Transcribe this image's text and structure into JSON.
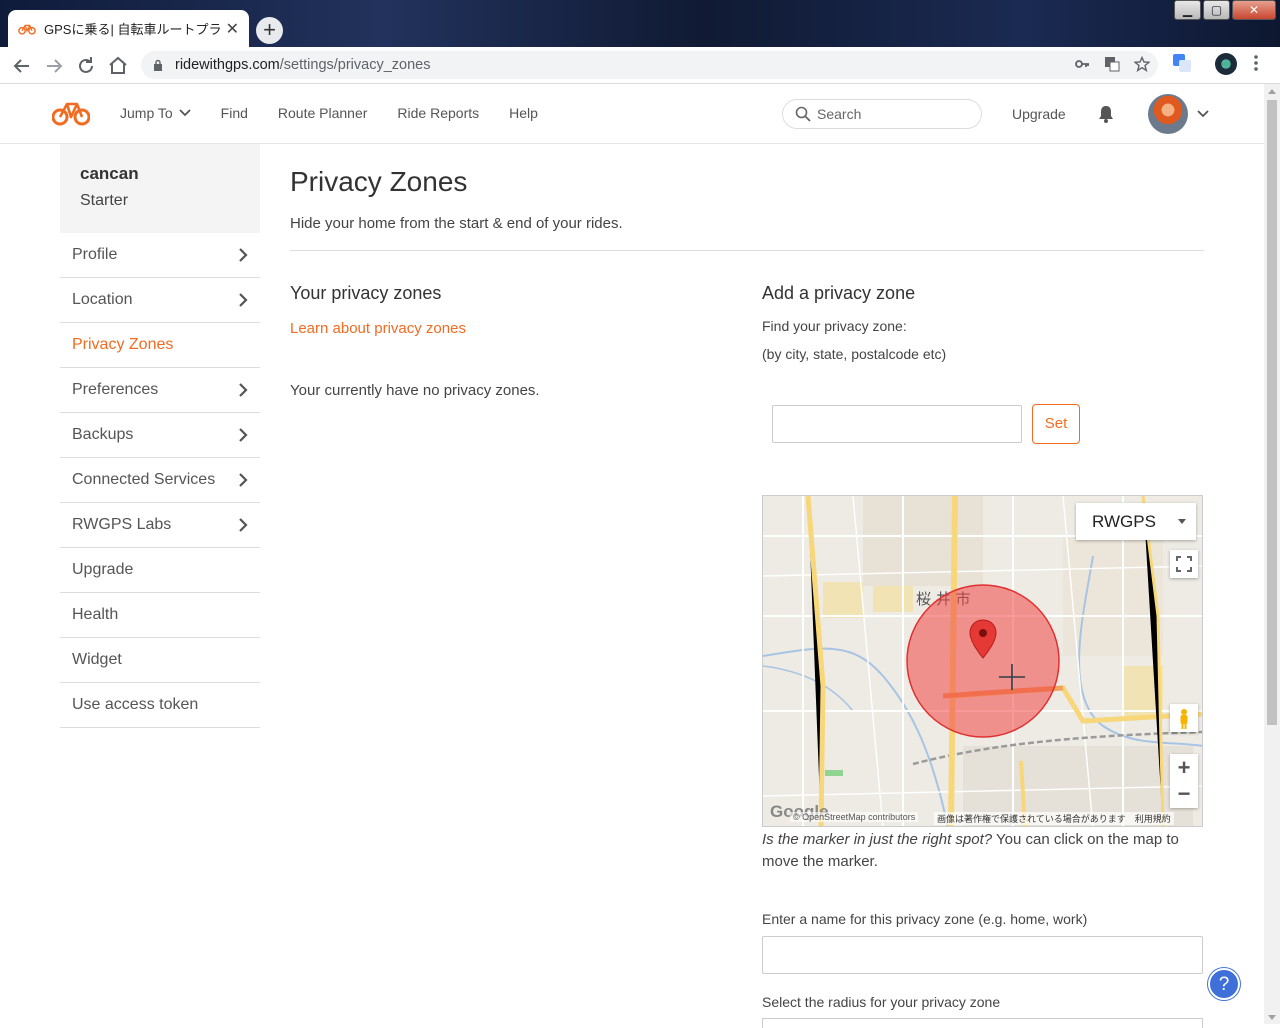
{
  "browser": {
    "tab_title": "GPSに乗る| 自転車ルートプラン",
    "tab_close": "✕",
    "new_tab": "+",
    "url_host": "ridewithgps.com",
    "url_path": "/settings/privacy_zones"
  },
  "header": {
    "nav": [
      {
        "label": "Jump To"
      },
      {
        "label": "Find"
      },
      {
        "label": "Route Planner"
      },
      {
        "label": "Ride Reports"
      },
      {
        "label": "Help"
      }
    ],
    "search_placeholder": "Search",
    "upgrade": "Upgrade",
    "accent_color": "#f26b21"
  },
  "sidebar": {
    "user_name": "cancan",
    "user_plan": "Starter",
    "items": [
      {
        "label": "Profile"
      },
      {
        "label": "Location"
      },
      {
        "label": "Privacy Zones"
      },
      {
        "label": "Preferences"
      },
      {
        "label": "Backups"
      },
      {
        "label": "Connected Services"
      },
      {
        "label": "RWGPS Labs"
      },
      {
        "label": "Upgrade"
      },
      {
        "label": "Health"
      },
      {
        "label": "Widget"
      },
      {
        "label": "Use access token"
      }
    ]
  },
  "main": {
    "title": "Privacy Zones",
    "subtitle": "Hide your home from the start & end of your rides.",
    "your_zones_heading": "Your privacy zones",
    "learn_link": "Learn about privacy zones",
    "no_zones_text": "Your currently have no privacy zones.",
    "add_heading": "Add a privacy zone",
    "find_label": "Find your privacy zone:",
    "find_hint": "(by city, state, postalcode etc)",
    "find_value": "",
    "set_button": "Set",
    "map": {
      "layer": "RWGPS",
      "city_label": "桜 井 市",
      "google": "Google",
      "attribution": "© OpenStreetMap contributors",
      "terms": "画像は著作権で保護されている場合があります　利用規約",
      "zoom_in": "+",
      "zoom_out": "−"
    },
    "marker_question": "Is the marker in just the right spot?",
    "marker_hint": " You can click on the map to move the marker.",
    "name_label": "Enter a name for this privacy zone (e.g. home, work)",
    "name_value": "",
    "radius_label": "Select the radius for your privacy zone"
  },
  "help_button": "?"
}
